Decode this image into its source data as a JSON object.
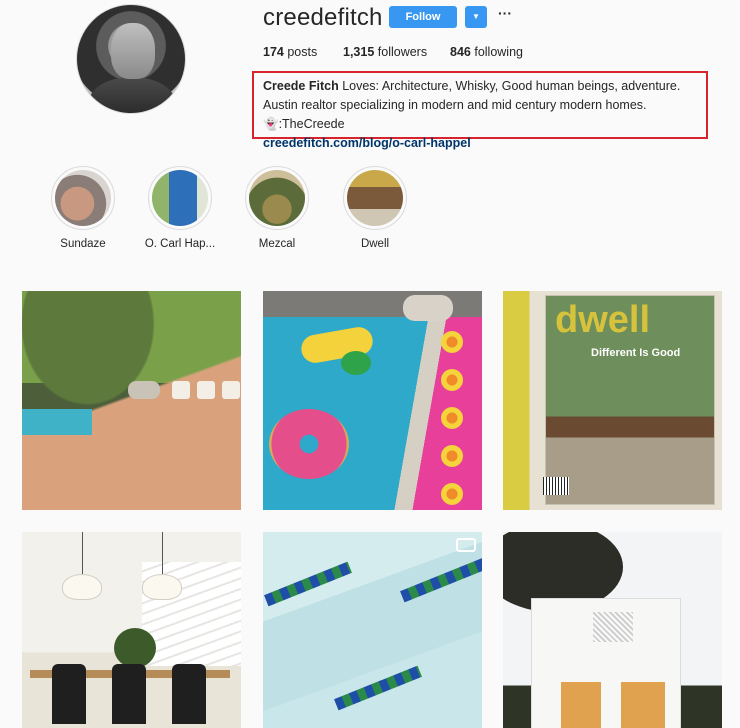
{
  "profile": {
    "username": "creedefitch",
    "follow_label": "Follow",
    "dropdown_glyph": "▼",
    "more_glyph": "···",
    "stats": {
      "posts_count": "174",
      "posts_label": "posts",
      "followers_count": "1,315",
      "followers_label": "followers",
      "following_count": "846",
      "following_label": "following"
    },
    "bio": {
      "name": "Creede Fitch",
      "text": "Loves: Architecture, Whisky, Good human beings, adventure. Austin realtor specializing in modern and mid century modern homes. 👻:TheCreede",
      "link": "creedefitch.com/blog/o-carl-happel"
    }
  },
  "highlights": [
    {
      "label": "Sundaze",
      "color": "#b07a68"
    },
    {
      "label": "O. Carl Hap...",
      "color": "#2d6fb8"
    },
    {
      "label": "Mezcal",
      "color": "#7a6d3e"
    },
    {
      "label": "Dwell",
      "color": "#b58a3c"
    }
  ],
  "posts": [
    {
      "subject": "backyard-pool-dogs"
    },
    {
      "subject": "pool-floats-dog"
    },
    {
      "subject": "dwell-magazine",
      "title": "dwell",
      "subtitle": "Different Is Good"
    },
    {
      "subject": "dining-room-staircase"
    },
    {
      "subject": "pool-tiles",
      "icon": "video-icon"
    },
    {
      "subject": "modern-house-facade"
    }
  ],
  "colors": {
    "accent": "#3897f0",
    "highlight_box": "#d7232b",
    "link": "#003569"
  }
}
